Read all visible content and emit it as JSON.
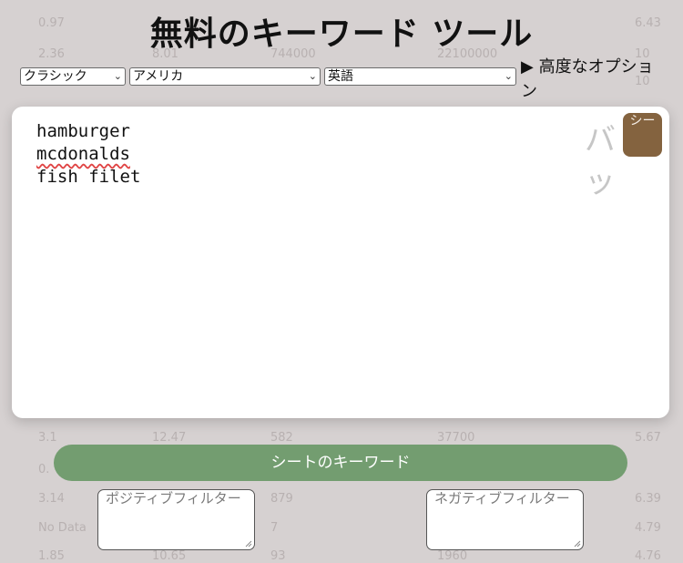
{
  "title": "無料のキーワード ツール",
  "controls": {
    "mode": "クラシック",
    "country": "アメリカ",
    "language": "英語",
    "advanced_options": "▶ 高度なオプション"
  },
  "editor": {
    "lines": [
      "hamburger",
      "mcdonalds",
      "fish filet"
    ],
    "batch_label": "バッ",
    "sheet_button": "シー"
  },
  "primary_button": "シートのキーワード",
  "filters": {
    "positive_placeholder": "ポジティブフィルター",
    "negative_placeholder": "ネガティブフィルター"
  },
  "background_rows": [
    [
      "0.97",
      "",
      "",
      "",
      "6.43"
    ],
    [
      "2.36",
      "8.01",
      "744000",
      "22100000",
      "10"
    ],
    [
      "",
      "",
      "",
      "",
      "10"
    ],
    [
      "3.1",
      "12.47",
      "582",
      "37700",
      "5.67"
    ],
    [
      "0.",
      "",
      "",
      "",
      ""
    ],
    [
      "3.14",
      "",
      "879",
      "",
      "6.39"
    ],
    [
      "No Data",
      "",
      "7",
      "",
      "4.79"
    ],
    [
      "1.85",
      "10.65",
      "93",
      "1960",
      "4.76"
    ]
  ],
  "colors": {
    "background": "#d6d1d1",
    "primary_button": "#739d70",
    "sheet_button": "#84633f",
    "misspelling_underline": "#e04545"
  }
}
